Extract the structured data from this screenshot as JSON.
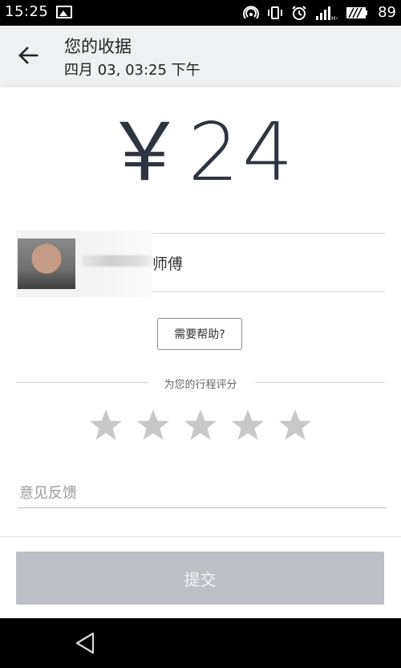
{
  "status_bar": {
    "time": "15:25",
    "battery": "89",
    "icons": [
      "image-icon",
      "hotspot-icon",
      "vibrate-icon",
      "alarm-icon",
      "signal-icon",
      "battery-icon"
    ]
  },
  "header": {
    "title": "您的收据",
    "subtitle": "四月 03, 03:25 下午",
    "back_icon": "back-arrow-icon"
  },
  "receipt": {
    "amount": "￥24"
  },
  "driver": {
    "name_suffix": "师傅"
  },
  "help": {
    "label": "需要帮助?"
  },
  "rating": {
    "label": "为您的行程评分",
    "max_stars": 5,
    "selected": 0,
    "star_color": "#c8c8c8"
  },
  "feedback": {
    "placeholder": "意见反馈",
    "value": ""
  },
  "submit": {
    "label": "提交",
    "color": "#bdbfc6"
  },
  "nav": {
    "back_icon": "nav-back-icon"
  }
}
